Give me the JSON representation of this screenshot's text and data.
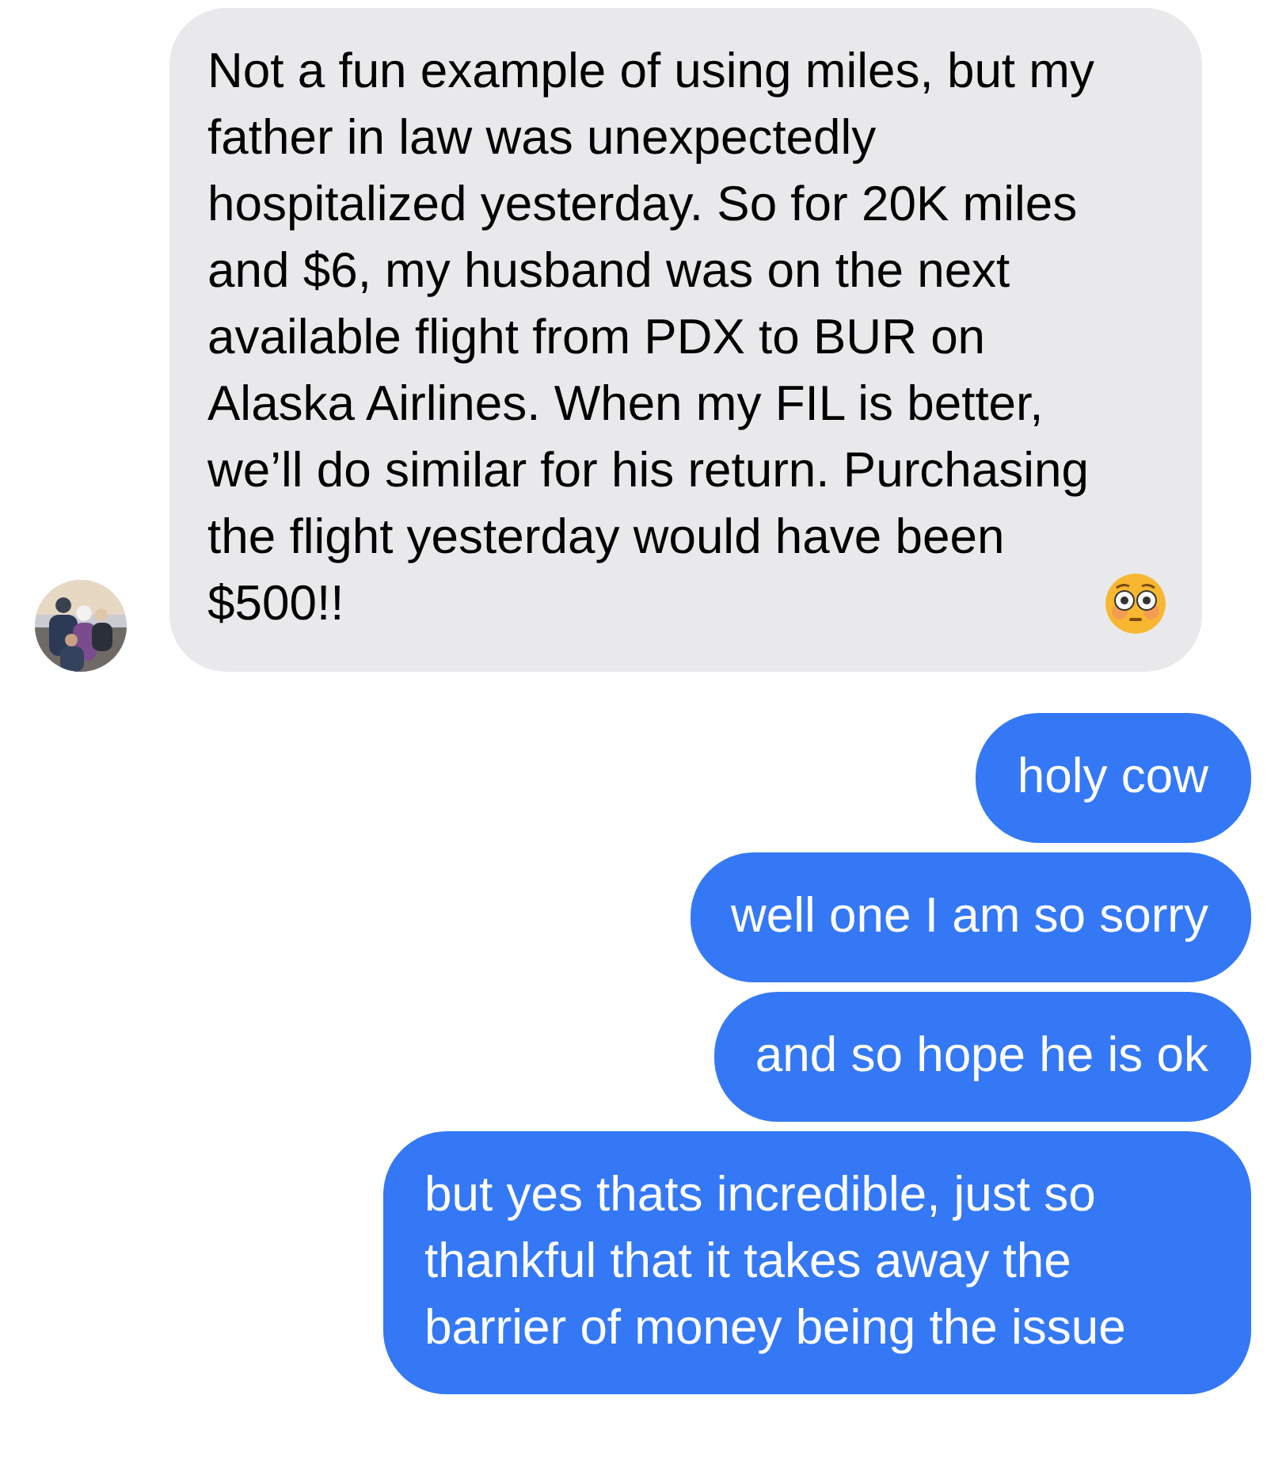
{
  "messages": [
    {
      "kind": "incoming",
      "text": "Not a fun example of using miles, but my father in law was unexpectedly hospitalized yesterday. So for 20K miles and $6, my husband was on the next available flight from PDX to BUR on Alaska Airlines. When my FIL is better, we’ll do similar for his return. Purchasing the flight yesterday would have been $500!!"
    },
    {
      "kind": "outgoing",
      "text": "holy cow"
    },
    {
      "kind": "outgoing",
      "text": "well one I am so sorry"
    },
    {
      "kind": "outgoing",
      "text": "and so hope he is ok"
    },
    {
      "kind": "outgoing",
      "text": "but yes thats incredible, just so thankful that it takes away the barrier of money being the issue"
    }
  ]
}
